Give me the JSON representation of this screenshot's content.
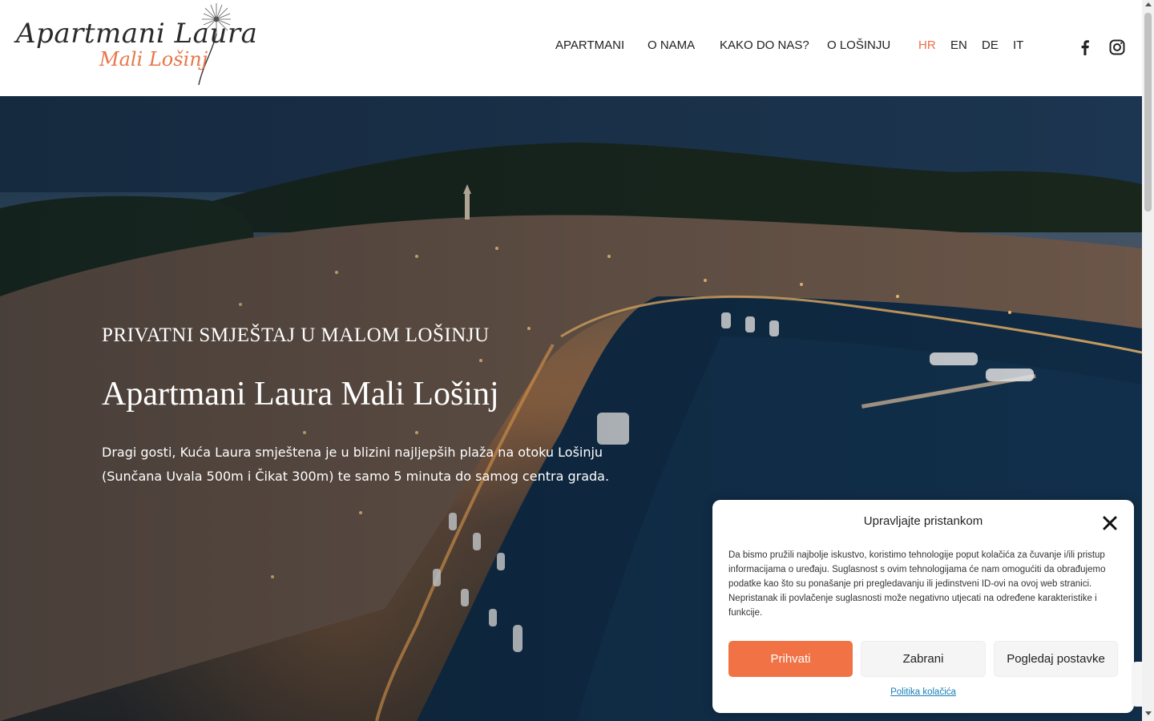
{
  "header": {
    "logo": {
      "name": "Apartmani Laura",
      "subtitle": "Mali Lošinj"
    },
    "nav": [
      {
        "label": "APARTMANI"
      },
      {
        "label": "O NAMA"
      },
      {
        "label": "KAKO DO NAS?"
      },
      {
        "label": "O LOŠINJU"
      }
    ],
    "languages": [
      {
        "label": "HR",
        "active": true
      },
      {
        "label": "EN",
        "active": false
      },
      {
        "label": "DE",
        "active": false
      },
      {
        "label": "IT",
        "active": false
      }
    ],
    "social": [
      "facebook-icon",
      "instagram-icon"
    ]
  },
  "hero": {
    "kicker": "PRIVATNI SMJEŠTAJ U MALOM LOŠINJU",
    "title": "Apartmani Laura Mali Lošinj",
    "text": "Dragi gosti, Kuća Laura smještena je u blizini najljepših plaža na otoku Lošinju (Sunčana Uvala 500m i Čikat 300m) te samo 5 minuta do samog centra grada."
  },
  "cookie_banner": {
    "title": "Upravljajte pristankom",
    "body": "Da bismo pružili najbolje iskustvo, koristimo tehnologije poput kolačića za čuvanje i/ili pristup informacijama o uređaju. Suglasnost s ovim tehnologijama će nam omogućiti da obrađujemo podatke kao što su ponašanje pri pregledavanju ili jedinstveni ID-ovi na ovoj web stranici. Nepristanak ili povlačenje suglasnosti može negativno utjecati na određene karakteristike i funkcije.",
    "accept_label": "Prihvati",
    "deny_label": "Zabrani",
    "prefs_label": "Pogledaj postavke",
    "policy_link": "Politika kolačića"
  },
  "colors": {
    "accent": "#ef6c45",
    "accept_button": "#f07245",
    "link": "#1a7fb8"
  }
}
